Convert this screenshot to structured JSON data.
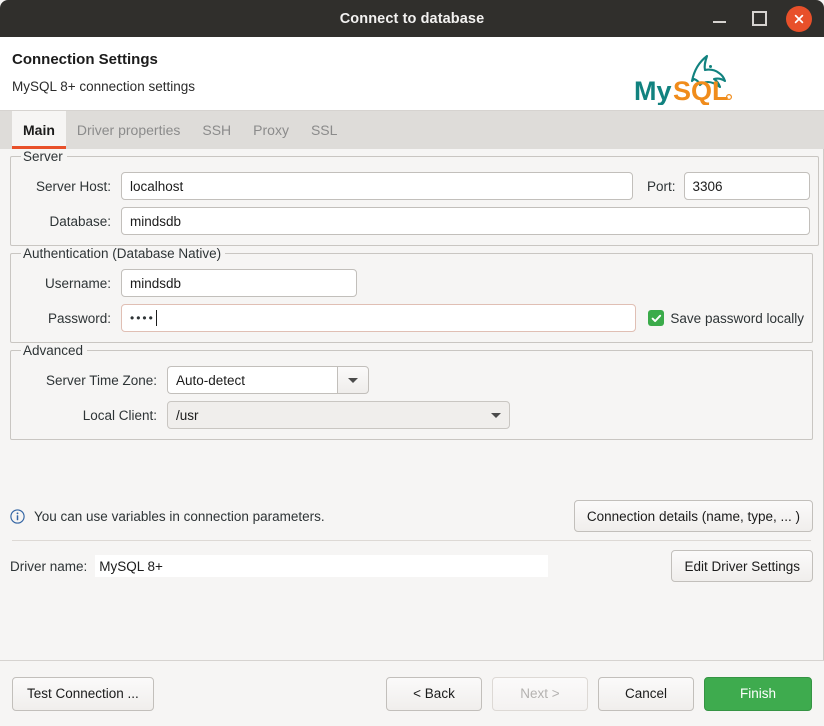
{
  "window": {
    "title": "Connect to database",
    "controls": {
      "minimize": "minimize-icon",
      "maximize": "maximize-icon",
      "close": "close-icon"
    }
  },
  "header": {
    "title": "Connection Settings",
    "subtitle": "MySQL 8+ connection settings",
    "logo_alt": "MySQL",
    "logo_text_my": "My",
    "logo_text_sql": "SQL",
    "logo_color_teal": "#11827f",
    "logo_color_orange": "#f08c1b"
  },
  "tabs": [
    {
      "label": "Main",
      "active": true
    },
    {
      "label": "Driver properties",
      "active": false
    },
    {
      "label": "SSH",
      "active": false
    },
    {
      "label": "Proxy",
      "active": false
    },
    {
      "label": "SSL",
      "active": false
    }
  ],
  "accent_color": "#e8502a",
  "server_group": {
    "legend": "Server",
    "host_label": "Server Host:",
    "host_value": "localhost",
    "port_label": "Port:",
    "port_value": "3306",
    "database_label": "Database:",
    "database_value": "mindsdb"
  },
  "auth_group": {
    "legend": "Authentication (Database Native)",
    "username_label": "Username:",
    "username_value": "mindsdb",
    "password_label": "Password:",
    "password_masked": "••••",
    "save_password_label": "Save password locally",
    "save_password_checked": true,
    "checkbox_color": "#3bab4a"
  },
  "advanced_group": {
    "legend": "Advanced",
    "timezone_label": "Server Time Zone:",
    "timezone_value": "Auto-detect",
    "local_client_label": "Local Client:",
    "local_client_value": "/usr"
  },
  "info": {
    "icon": "info-circle-icon",
    "text": "You can use variables in connection parameters.",
    "icon_color": "#3465a4",
    "details_button": "Connection details (name, type, ... )"
  },
  "driver": {
    "label": "Driver name:",
    "value": "MySQL 8+",
    "edit_button": "Edit Driver Settings"
  },
  "footer": {
    "test_connection": "Test Connection ...",
    "back": "< Back",
    "next": "Next >",
    "next_enabled": false,
    "cancel": "Cancel",
    "finish": "Finish",
    "finish_color": "#3eab4e"
  }
}
